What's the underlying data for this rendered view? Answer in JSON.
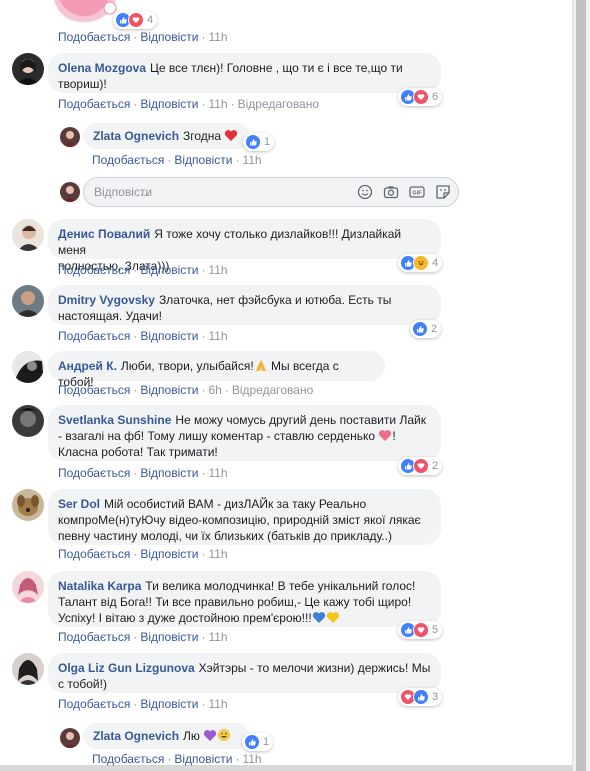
{
  "common": {
    "like": "Подобається",
    "reply": "Відповісти",
    "edited": "Відредаговано",
    "sep": "·"
  },
  "top": {
    "count": "4",
    "time": "11h"
  },
  "comments": [
    {
      "name": "Olena Mozgova",
      "text1": "Це все тлєн)! Головне , що ти є і все те,що ти",
      "text2": "твориш)!",
      "time": "11h",
      "count": "6"
    },
    {
      "name": "Zlata Ognevich",
      "text1": "Згодна",
      "time": "11h",
      "count": "1"
    },
    {
      "name": "Денис Повалий",
      "text1": "Я тоже хочу столько дизлайков!!! Дизлайкай меня",
      "text2": "полностью, Злата)))",
      "time": "11h",
      "count": "4"
    },
    {
      "name": "Dmitry Vygovsky",
      "text1": "Златочка, нет фэйсбука и ютюба. Есть ты",
      "text2": "настоящая. Удачи!",
      "time": "11h",
      "count": "2"
    },
    {
      "name": "Андрей К.",
      "text1": "Люби, твори, улыбайся!",
      "text1b": " Мы всегда с тобой!",
      "time": "6h"
    },
    {
      "name": "Svetlanka Sunshine",
      "text1": "Не можу чомусь другий день поставити Лайк",
      "text2": "- взагалі на фб! Тому лишу коментар - ставлю серденько",
      "text3": "Класна робота! Так тримати!",
      "time": "11h",
      "count": "2"
    },
    {
      "name": "Ser Dol",
      "text1": "Мій особистий ВАМ - дизЛАЙк за таку Реально",
      "text2": "компроМе(н)туЮчу відео-композицію, природній зміст якої лякає",
      "text3": "певну частину молоді, чи їх близьких (батьків до прикладу..)",
      "time": "11h"
    },
    {
      "name": "Natalika Karpa",
      "text1": "Ти велика молодчинка! В тебе унікальний голос!",
      "text2": "Талант від Бога!! Ти все правильно робиш,- Це кажу тобі щиро!",
      "text3": "Успіху! І вітаю з дуже достойною прем'єрою!!!",
      "time": "11h",
      "count": "5"
    },
    {
      "name": "Olga Liz Gun Lizgunova",
      "text1": "Хэйтэры - то мелочи жизни) держись! Мы",
      "text2": "с тобой!)",
      "time": "11h",
      "count": "3"
    },
    {
      "name": "Zlata Ognevich",
      "text1": "Лю",
      "time": "11h",
      "count": "1"
    }
  ]
}
